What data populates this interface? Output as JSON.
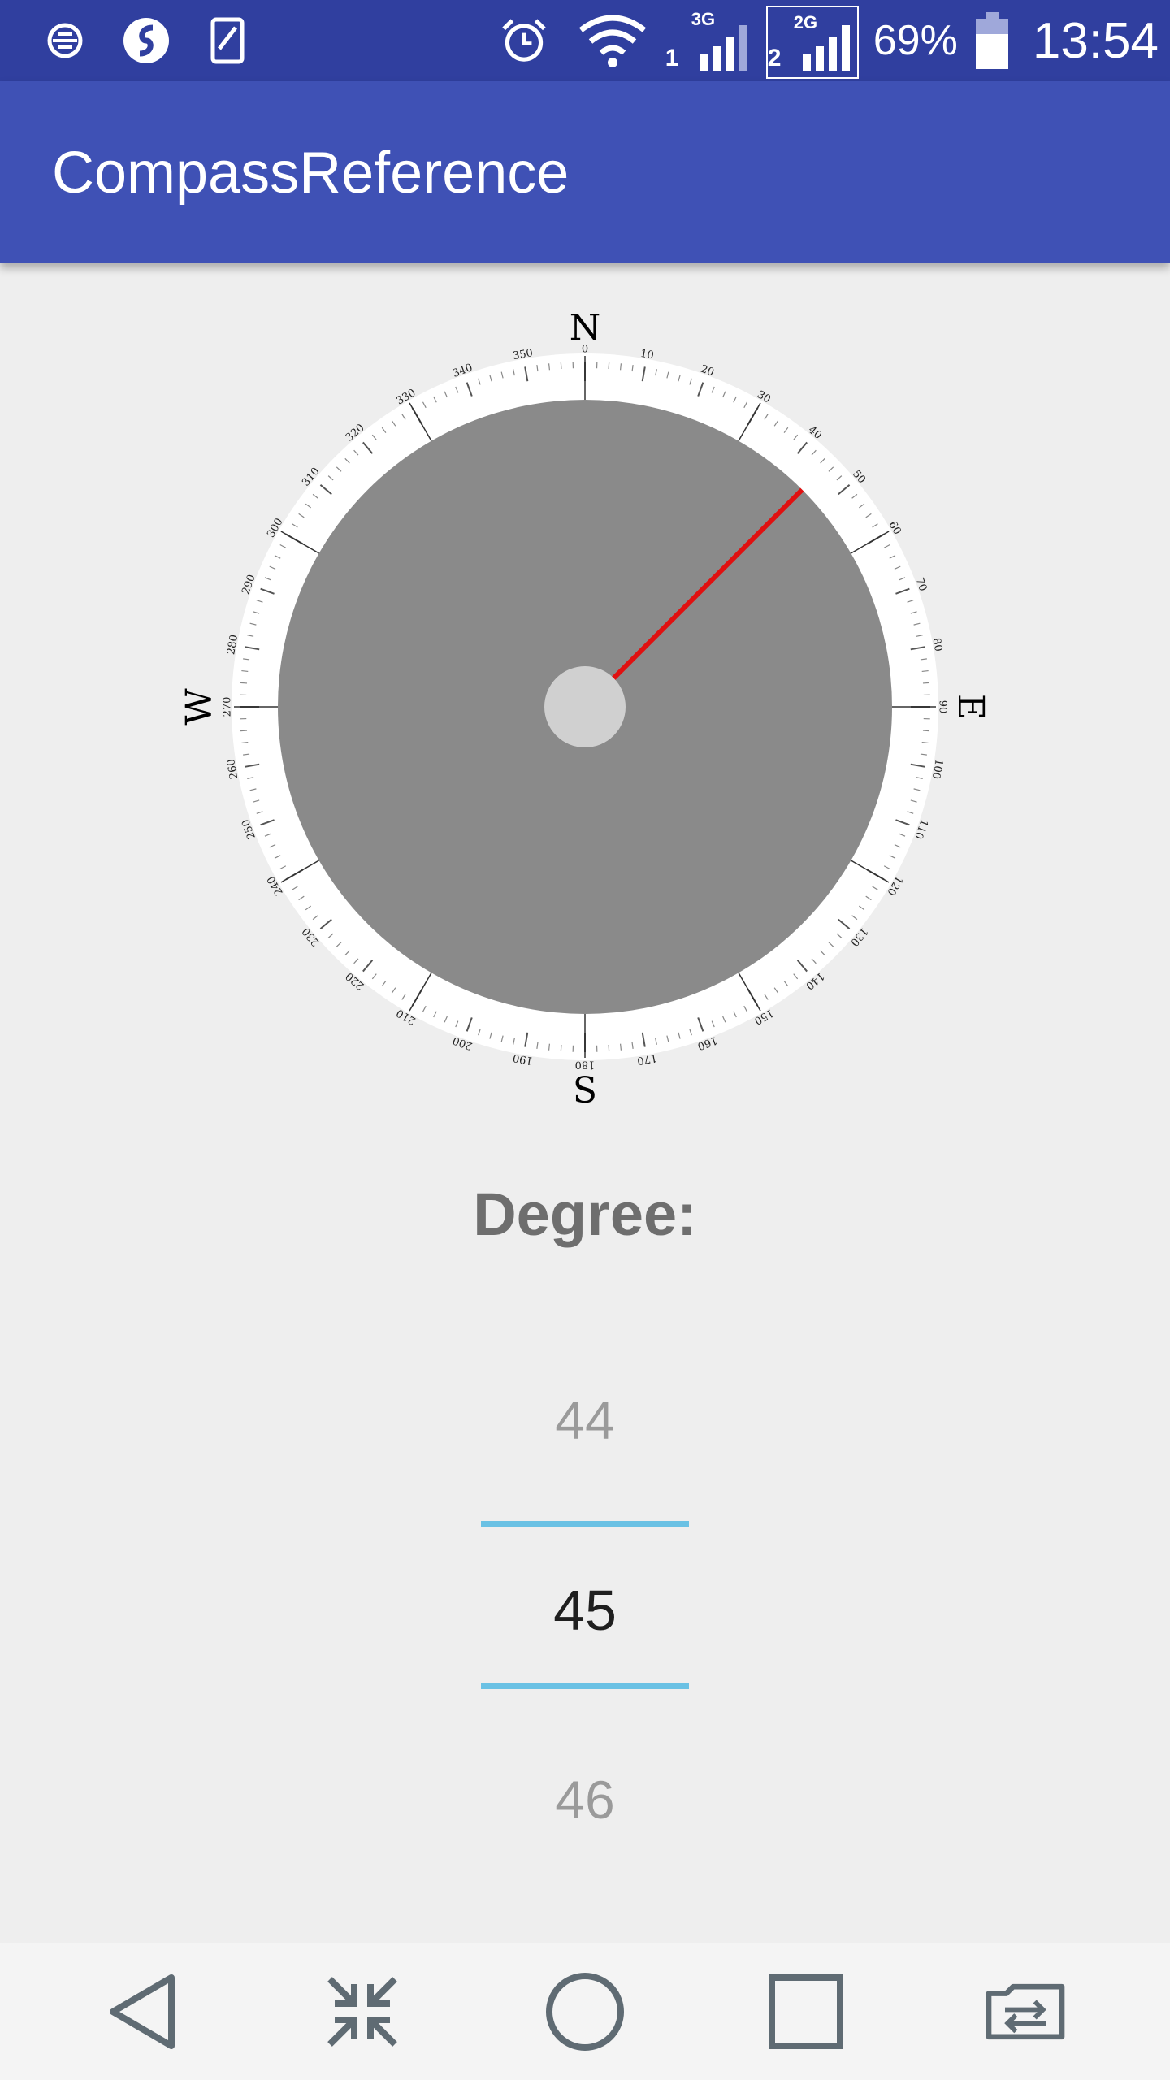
{
  "status_bar": {
    "left_icons": [
      "notification-app-icon",
      "browser-app-icon",
      "device-app-icon"
    ],
    "alarm_icon": "alarm-clock-icon",
    "wifi_icon": "wifi-icon",
    "sim1": {
      "network": "3G",
      "slot": "1"
    },
    "sim2": {
      "network": "2G",
      "slot": "2"
    },
    "battery_percent": "69%",
    "time": "13:54"
  },
  "app_bar": {
    "title": "CompassReference"
  },
  "compass": {
    "cardinals": {
      "north": "N",
      "east": "E",
      "south": "S",
      "west": "W"
    },
    "heading_degrees": 45,
    "needle_color": "#e01010",
    "dial_color": "#8a8a8a",
    "hub_color": "#d0d0d0"
  },
  "degree": {
    "label": "Degree:",
    "picker": {
      "previous": "44",
      "current": "45",
      "next": "46"
    },
    "divider_color": "#6ac1e4"
  },
  "nav_bar": {
    "buttons": [
      "back-icon",
      "collapse-icon",
      "home-icon",
      "recents-icon",
      "switch-sim-icon"
    ]
  }
}
